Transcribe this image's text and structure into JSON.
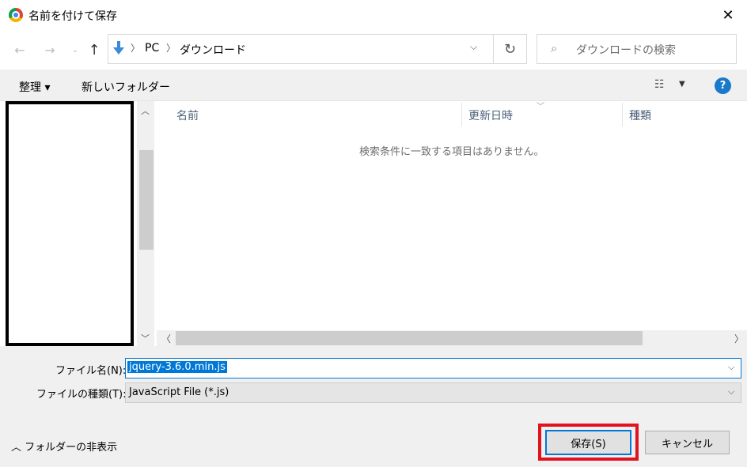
{
  "window": {
    "title": "名前を付けて保存",
    "close_glyph": "✕"
  },
  "address": {
    "segments": [
      "PC",
      "ダウンロード"
    ]
  },
  "search": {
    "placeholder": "ダウンロードの検索"
  },
  "toolbar": {
    "organize_label": "整理 ▾",
    "new_folder_label": "新しいフォルダー",
    "help_glyph": "?"
  },
  "file_list": {
    "columns": [
      "名前",
      "更新日時",
      "種類"
    ],
    "empty_message": "検索条件に一致する項目はありません。"
  },
  "form": {
    "file_name_label": "ファイル名(N):",
    "file_name_value": "jquery-3.6.0.min.js",
    "file_type_label": "ファイルの種類(T):",
    "file_type_value": "JavaScript File (*.js)"
  },
  "footer": {
    "hide_folders_label": "フォルダーの非表示",
    "save_label": "保存(S)",
    "cancel_label": "キャンセル"
  },
  "colors": {
    "accent": "#0078d7",
    "highlight": "#e0131f",
    "help": "#1979ca"
  }
}
